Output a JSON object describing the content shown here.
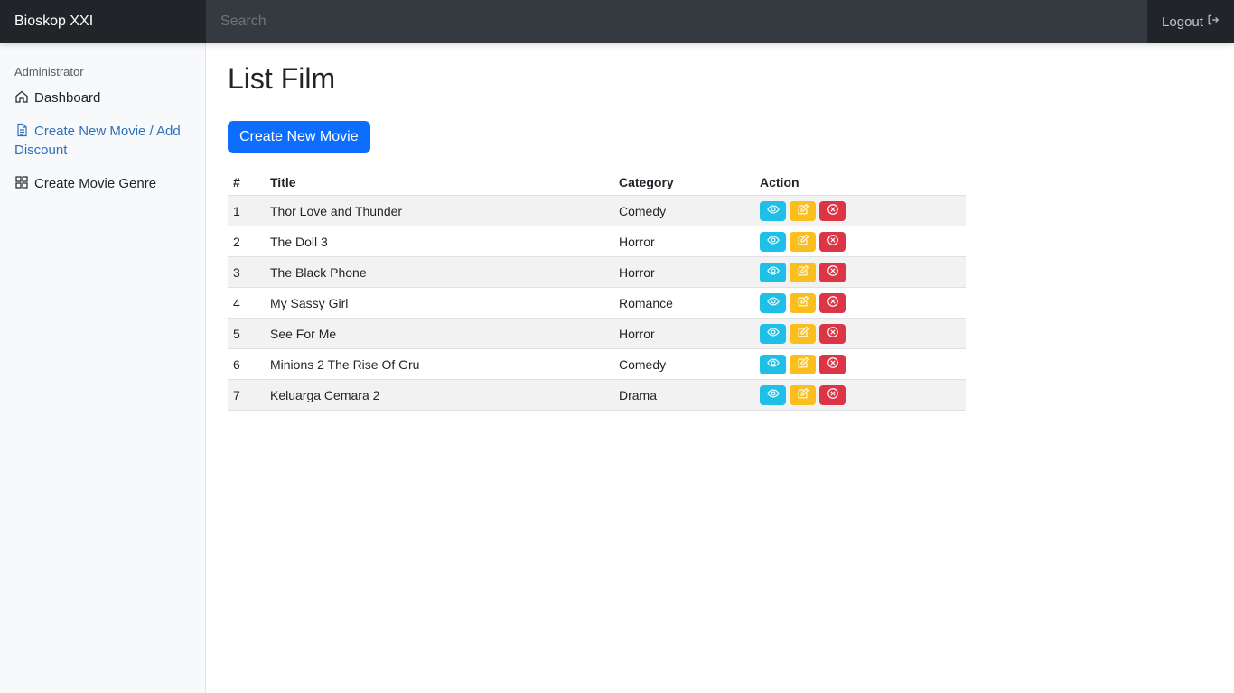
{
  "navbar": {
    "brand": "Bioskop XXI",
    "search_placeholder": "Search",
    "logout_label": "Logout"
  },
  "sidebar": {
    "heading": "Administrator",
    "items": [
      {
        "label": "Dashboard",
        "icon": "home-icon",
        "active": false
      },
      {
        "label": "Create New Movie / Add Discount",
        "icon": "file-icon",
        "active": true
      },
      {
        "label": "Create Movie Genre",
        "icon": "grid-icon",
        "active": false
      }
    ]
  },
  "main": {
    "title": "List Film",
    "create_button_label": "Create New Movie",
    "table": {
      "headers": [
        "#",
        "Title",
        "Category",
        "Action"
      ],
      "rows": [
        {
          "num": "1",
          "title": "Thor Love and Thunder",
          "category": "Comedy"
        },
        {
          "num": "2",
          "title": "The Doll 3",
          "category": "Horror"
        },
        {
          "num": "3",
          "title": "The Black Phone",
          "category": "Horror"
        },
        {
          "num": "4",
          "title": "My Sassy Girl",
          "category": "Romance"
        },
        {
          "num": "5",
          "title": "See For Me",
          "category": "Horror"
        },
        {
          "num": "6",
          "title": "Minions 2 The Rise Of Gru",
          "category": "Comedy"
        },
        {
          "num": "7",
          "title": "Keluarga Cemara 2",
          "category": "Drama"
        }
      ],
      "action_icons": [
        "eye-icon",
        "edit-icon",
        "delete-icon"
      ]
    }
  },
  "colors": {
    "navbar": "#343a40",
    "brand_bg": "#212529",
    "primary": "#0d6efd",
    "info": "#1fc0e8",
    "warning": "#fbbf1d",
    "danger": "#dc3545",
    "active_link": "#2f6fbd"
  }
}
